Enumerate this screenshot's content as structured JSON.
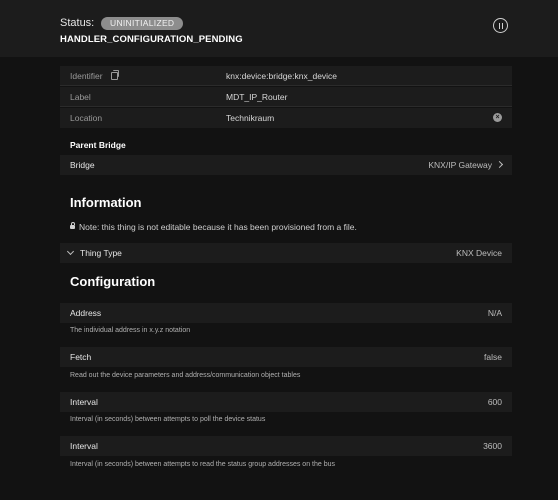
{
  "header": {
    "status_label": "Status:",
    "status_badge": "UNINITIALIZED",
    "status_detail": "HANDLER_CONFIGURATION_PENDING"
  },
  "properties": [
    {
      "label": "Identifier",
      "value": "knx:device:bridge:knx_device"
    },
    {
      "label": "Label",
      "value": "MDT_IP_Router"
    },
    {
      "label": "Location",
      "value": "Technikraum"
    }
  ],
  "parent_bridge": {
    "heading": "Parent Bridge",
    "label": "Bridge",
    "value": "KNX/IP Gateway"
  },
  "information": {
    "title": "Information",
    "note": "Note: this thing is not editable because it has been provisioned from a file.",
    "thing_type_label": "Thing Type",
    "thing_type_value": "KNX Device"
  },
  "configuration": {
    "title": "Configuration",
    "params": [
      {
        "label": "Address",
        "value": "N/A",
        "description": "The individual address in x.y.z notation"
      },
      {
        "label": "Fetch",
        "value": "false",
        "description": "Read out the device parameters and address/communication object tables"
      },
      {
        "label": "Interval",
        "value": "600",
        "description": "Interval (in seconds) between attempts to poll the device status"
      },
      {
        "label": "Interval",
        "value": "3600",
        "description": "Interval (in seconds) between attempts to read the status group addresses on the bus"
      }
    ]
  },
  "icons": {
    "pause": "pause-circle-icon",
    "copy": "copy-icon",
    "clear": "clear-icon",
    "chevron_right": "chevron-right-icon",
    "chevron_down": "chevron-down-icon",
    "lock": "lock-icon"
  },
  "colors": {
    "badge": "#8d8d8d",
    "background": "#121212",
    "panel": "#1c1c1c"
  }
}
